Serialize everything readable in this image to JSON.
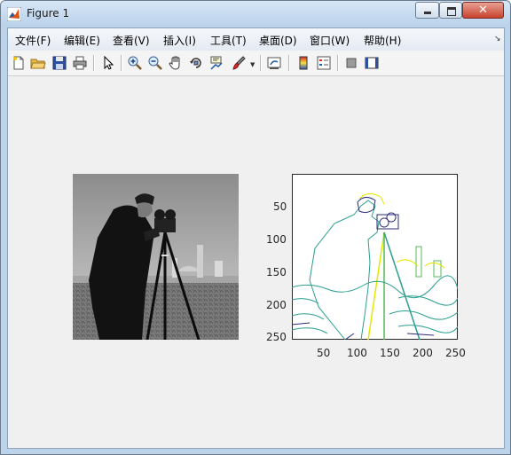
{
  "window": {
    "title": "Figure 1",
    "close_symbol": "✕"
  },
  "menubar": {
    "items": [
      {
        "label": "文件(F)"
      },
      {
        "label": "编辑(E)"
      },
      {
        "label": "查看(V)"
      },
      {
        "label": "插入(I)"
      },
      {
        "label": "工具(T)"
      },
      {
        "label": "桌面(D)"
      },
      {
        "label": "窗口(W)"
      },
      {
        "label": "帮助(H)"
      }
    ],
    "overflow_icon": "chevron-right-icon"
  },
  "toolbar": {
    "icons": [
      "new-figure-icon",
      "open-file-icon",
      "save-icon",
      "print-icon",
      "select-arrow-icon",
      "zoom-in-icon",
      "zoom-out-icon",
      "pan-hand-icon",
      "rotate-3d-icon",
      "data-cursor-icon",
      "brush-icon",
      "link-plot-icon",
      "colorbar-icon",
      "legend-icon",
      "hide-plot-tools-icon",
      "show-plot-tools-icon"
    ]
  },
  "figure": {
    "left_image": {
      "content": "cameraman grayscale photo"
    },
    "right_axes": {
      "plot_type": "contour of image",
      "ytick_labels": [
        "50",
        "100",
        "150",
        "200",
        "250"
      ],
      "xtick_labels": [
        "50",
        "100",
        "150",
        "200",
        "250"
      ],
      "colors": {
        "contour_teal": "#2a9e8f",
        "contour_yellow": "#e6e600",
        "contour_navy": "#2b2b7a",
        "contour_green": "#55b85a"
      }
    }
  }
}
